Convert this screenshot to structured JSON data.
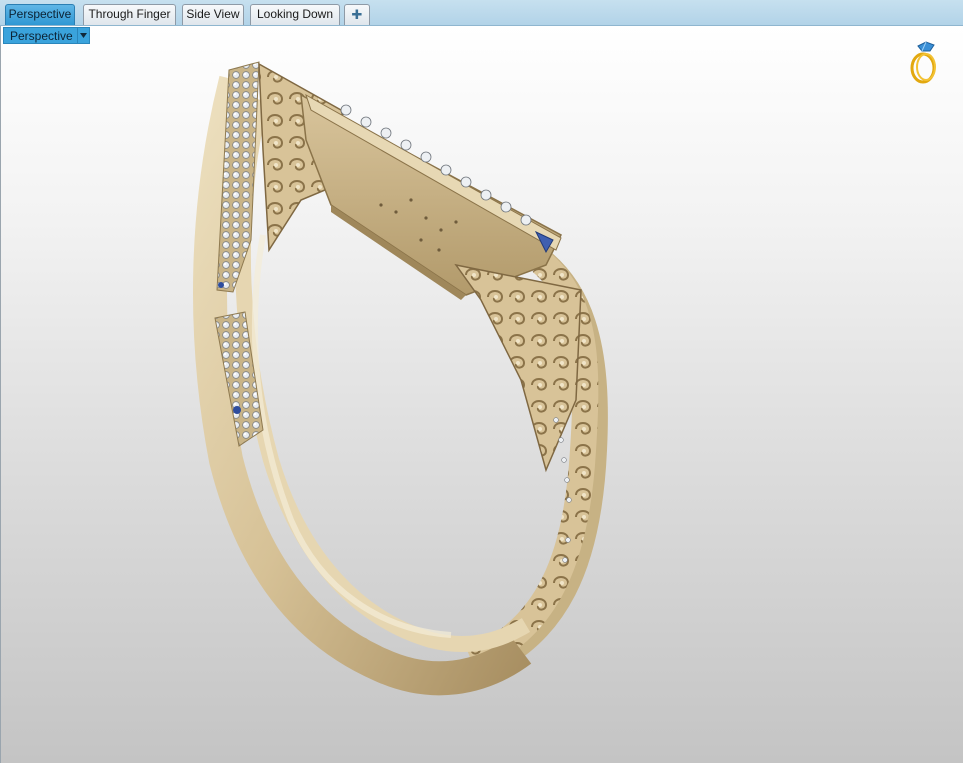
{
  "tabs": [
    {
      "label": "Perspective",
      "active": true
    },
    {
      "label": "Through Finger",
      "active": false
    },
    {
      "label": "Side View",
      "active": false
    },
    {
      "label": "Looking Down",
      "active": false
    }
  ],
  "add_tab_icon": "plus-icon",
  "viewport": {
    "label": "Perspective",
    "dropdown_icon": "triangle-down-icon",
    "corner_icon": "ring-icon"
  },
  "colors": {
    "active_tab": "#3aa3dc",
    "tabbar_bg": "#bcd9ea",
    "gold": "#d8c49b",
    "gold_shadow": "#9c8459"
  }
}
